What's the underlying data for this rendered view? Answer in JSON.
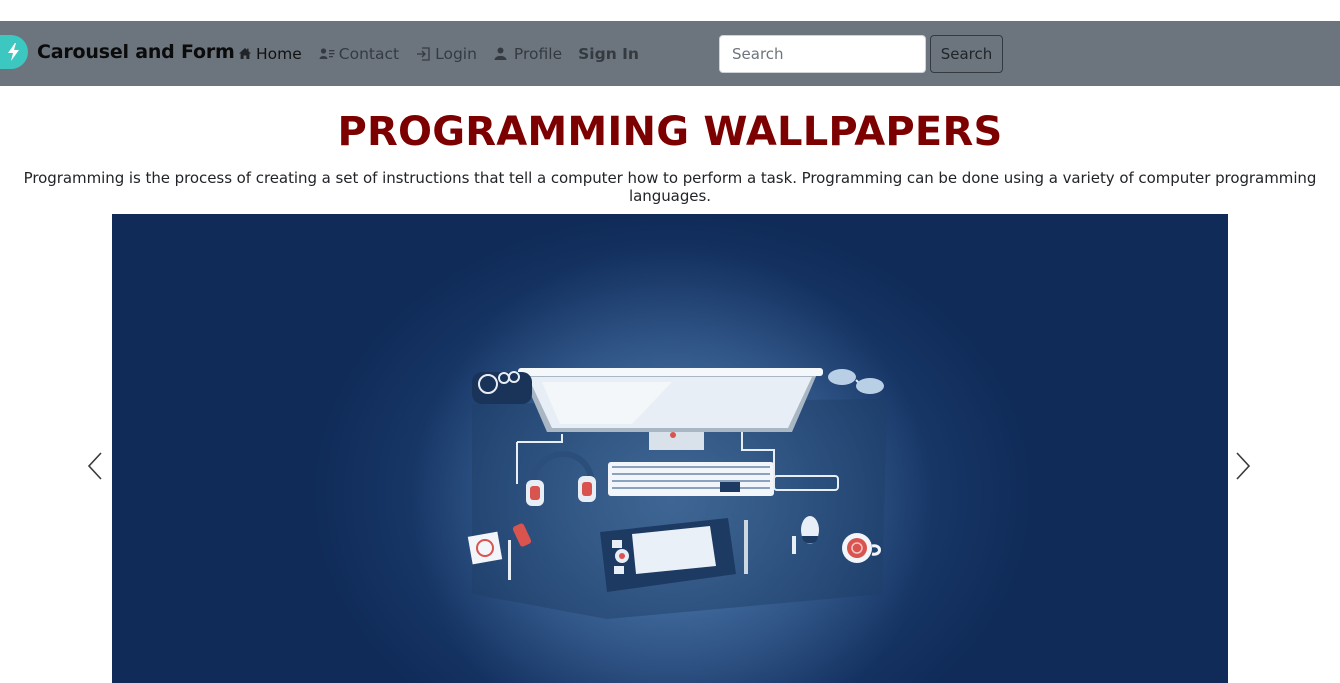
{
  "navbar": {
    "brand": "Carousel and Form",
    "items": [
      {
        "label": "Home",
        "icon": "home-icon"
      },
      {
        "label": "Contact",
        "icon": "contact-card-icon"
      },
      {
        "label": "Login",
        "icon": "login-icon"
      },
      {
        "label": "Profile",
        "icon": "person-icon"
      }
    ],
    "signin": "Sign In",
    "search_placeholder": "Search",
    "search_button": "Search"
  },
  "header": {
    "title": "PROGRAMMING WALLPAPERS",
    "description": "Programming is the process of creating a set of instructions that tell a computer how to perform a task. Programming can be done using a variety of computer programming languages."
  },
  "carousel": {
    "prev_icon": "chevron-left-icon",
    "next_icon": "chevron-right-icon",
    "slide_icon": "workstation-desk-illustration"
  },
  "colors": {
    "navbar": "#6c757d",
    "title": "#7d0000",
    "brand_logo": "#3cc8c0",
    "slide_background": "#163565"
  }
}
